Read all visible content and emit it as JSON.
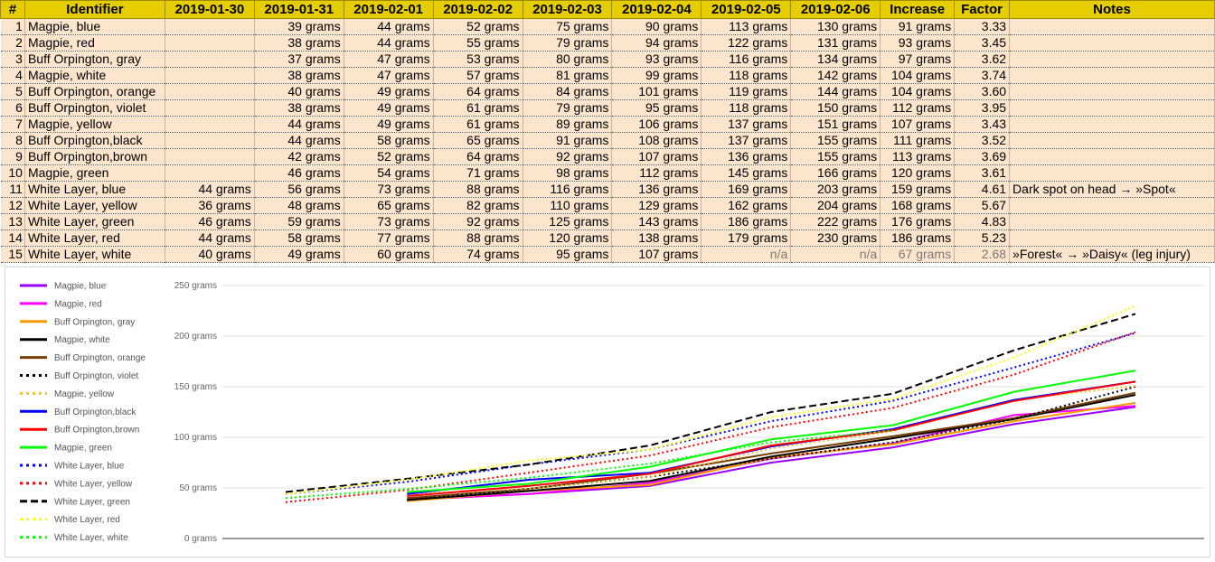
{
  "sheet": {
    "columns": [
      "#",
      "Identifier",
      "2019-01-30",
      "2019-01-31",
      "2019-02-01",
      "2019-02-02",
      "2019-02-03",
      "2019-02-04",
      "2019-02-05",
      "2019-02-06",
      "Increase",
      "Factor",
      "Notes"
    ],
    "rows": [
      {
        "n": "1",
        "id": "Magpie, blue",
        "d": [
          "",
          "39 grams",
          "44 grams",
          "52 grams",
          "75 grams",
          "90 grams",
          "113 grams",
          "130 grams"
        ],
        "inc": "91 grams",
        "f": "3.33",
        "note": ""
      },
      {
        "n": "2",
        "id": "Magpie, red",
        "d": [
          "",
          "38 grams",
          "44 grams",
          "55 grams",
          "79 grams",
          "94 grams",
          "122 grams",
          "131 grams"
        ],
        "inc": "93 grams",
        "f": "3.45",
        "note": ""
      },
      {
        "n": "3",
        "id": "Buff Orpington, gray",
        "d": [
          "",
          "37 grams",
          "47 grams",
          "53 grams",
          "80 grams",
          "93 grams",
          "116 grams",
          "134 grams"
        ],
        "inc": "97 grams",
        "f": "3.62",
        "note": ""
      },
      {
        "n": "4",
        "id": "Magpie, white",
        "d": [
          "",
          "38 grams",
          "47 grams",
          "57 grams",
          "81 grams",
          "99 grams",
          "118 grams",
          "142 grams"
        ],
        "inc": "104 grams",
        "f": "3.74",
        "note": ""
      },
      {
        "n": "5",
        "id": "Buff Orpington, orange",
        "d": [
          "",
          "40 grams",
          "49 grams",
          "64 grams",
          "84 grams",
          "101 grams",
          "119 grams",
          "144 grams"
        ],
        "inc": "104 grams",
        "f": "3.60",
        "note": ""
      },
      {
        "n": "6",
        "id": "Buff Orpington, violet",
        "d": [
          "",
          "38 grams",
          "49 grams",
          "61 grams",
          "79 grams",
          "95 grams",
          "118 grams",
          "150 grams"
        ],
        "inc": "112 grams",
        "f": "3.95",
        "note": ""
      },
      {
        "n": "7",
        "id": "Magpie, yellow",
        "d": [
          "",
          "44 grams",
          "49 grams",
          "61 grams",
          "89 grams",
          "106 grams",
          "137 grams",
          "151 grams"
        ],
        "inc": "107 grams",
        "f": "3.43",
        "note": ""
      },
      {
        "n": "8",
        "id": "Buff Orpington,black",
        "d": [
          "",
          "44 grams",
          "58 grams",
          "65 grams",
          "91 grams",
          "108 grams",
          "137 grams",
          "155 grams"
        ],
        "inc": "111 grams",
        "f": "3.52",
        "note": ""
      },
      {
        "n": "9",
        "id": "Buff Orpington,brown",
        "d": [
          "",
          "42 grams",
          "52 grams",
          "64 grams",
          "92 grams",
          "107 grams",
          "136 grams",
          "155 grams"
        ],
        "inc": "113 grams",
        "f": "3.69",
        "note": ""
      },
      {
        "n": "10",
        "id": "Magpie, green",
        "d": [
          "",
          "46 grams",
          "54 grams",
          "71 grams",
          "98 grams",
          "112 grams",
          "145 grams",
          "166 grams"
        ],
        "inc": "120 grams",
        "f": "3.61",
        "note": ""
      },
      {
        "n": "11",
        "id": "White Layer, blue",
        "d": [
          "44 grams",
          "56 grams",
          "73 grams",
          "88 grams",
          "116 grams",
          "136 grams",
          "169 grams",
          "203 grams"
        ],
        "inc": "159 grams",
        "f": "4.61",
        "note": "Dark spot on head → »Spot«"
      },
      {
        "n": "12",
        "id": "White Layer, yellow",
        "d": [
          "36 grams",
          "48 grams",
          "65 grams",
          "82 grams",
          "110 grams",
          "129 grams",
          "162 grams",
          "204 grams"
        ],
        "inc": "168 grams",
        "f": "5.67",
        "note": ""
      },
      {
        "n": "13",
        "id": "White Layer, green",
        "d": [
          "46 grams",
          "59 grams",
          "73 grams",
          "92 grams",
          "125 grams",
          "143 grams",
          "186 grams",
          "222 grams"
        ],
        "inc": "176 grams",
        "f": "4.83",
        "note": ""
      },
      {
        "n": "14",
        "id": "White Layer, red",
        "d": [
          "44 grams",
          "58 grams",
          "77 grams",
          "88 grams",
          "120 grams",
          "138 grams",
          "179 grams",
          "230 grams"
        ],
        "inc": "186 grams",
        "f": "5.23",
        "note": ""
      },
      {
        "n": "15",
        "id": "White Layer, white",
        "d": [
          "40 grams",
          "49 grams",
          "60 grams",
          "74 grams",
          "95 grams",
          "107 grams",
          "n/a",
          "n/a"
        ],
        "inc": "67 grams",
        "f": "2.68",
        "note": "»Forest« → »Daisy« (leg injury)"
      }
    ]
  },
  "chart_data": {
    "type": "line",
    "title": "",
    "xlabel": "",
    "ylabel": "",
    "ylim": [
      0,
      250
    ],
    "y_ticks": [
      "0 grams",
      "50 grams",
      "100 grams",
      "150 grams",
      "200 grams",
      "250 grams"
    ],
    "y_tick_values": [
      0,
      50,
      100,
      150,
      200,
      250
    ],
    "x": [
      "2019-01-30",
      "2019-01-31",
      "2019-02-01",
      "2019-02-02",
      "2019-02-03",
      "2019-02-04",
      "2019-02-05",
      "2019-02-06"
    ],
    "x_labels_visible": false,
    "grid": true,
    "legend_position": "left",
    "series": [
      {
        "name": "Magpie, blue",
        "color": "#9900ff",
        "dash": "solid",
        "values": [
          null,
          39,
          44,
          52,
          75,
          90,
          113,
          130
        ]
      },
      {
        "name": "Magpie, red",
        "color": "#ff00ff",
        "dash": "solid",
        "values": [
          null,
          38,
          44,
          55,
          79,
          94,
          122,
          131
        ]
      },
      {
        "name": "Buff Orpington, gray",
        "color": "#ff9900",
        "dash": "solid",
        "values": [
          null,
          37,
          47,
          53,
          80,
          93,
          116,
          134
        ]
      },
      {
        "name": "Magpie, white",
        "color": "#000000",
        "dash": "solid",
        "values": [
          null,
          38,
          47,
          57,
          81,
          99,
          118,
          142
        ]
      },
      {
        "name": "Buff Orpington, orange",
        "color": "#783f04",
        "dash": "solid",
        "values": [
          null,
          40,
          49,
          64,
          84,
          101,
          119,
          144
        ]
      },
      {
        "name": "Buff Orpington, violet",
        "color": "#000000",
        "dash": "dotted",
        "values": [
          null,
          38,
          49,
          61,
          79,
          95,
          118,
          150
        ]
      },
      {
        "name": "Magpie, yellow",
        "color": "#f1c232",
        "dash": "dotted",
        "values": [
          null,
          44,
          49,
          61,
          89,
          106,
          137,
          151
        ]
      },
      {
        "name": "Buff Orpington,black",
        "color": "#0000ff",
        "dash": "solid",
        "values": [
          null,
          44,
          58,
          65,
          91,
          108,
          137,
          155
        ]
      },
      {
        "name": "Buff Orpington,brown",
        "color": "#ff0000",
        "dash": "solid",
        "values": [
          null,
          42,
          52,
          64,
          92,
          107,
          136,
          155
        ]
      },
      {
        "name": "Magpie, green",
        "color": "#00ff00",
        "dash": "solid",
        "values": [
          null,
          46,
          54,
          71,
          98,
          112,
          145,
          166
        ]
      },
      {
        "name": "White Layer, blue",
        "color": "#0000ff",
        "dash": "dotted",
        "values": [
          44,
          56,
          73,
          88,
          116,
          136,
          169,
          203
        ]
      },
      {
        "name": "White Layer, yellow",
        "color": "#ff0000",
        "dash": "dotted",
        "values": [
          36,
          48,
          65,
          82,
          110,
          129,
          162,
          204
        ]
      },
      {
        "name": "White Layer, green",
        "color": "#000000",
        "dash": "dashed",
        "values": [
          46,
          59,
          73,
          92,
          125,
          143,
          186,
          222
        ]
      },
      {
        "name": "White Layer, red",
        "color": "#ffff00",
        "dash": "dotted",
        "values": [
          44,
          58,
          77,
          88,
          120,
          138,
          179,
          230
        ]
      },
      {
        "name": "White Layer, white",
        "color": "#00ff00",
        "dash": "dotted",
        "values": [
          40,
          49,
          60,
          74,
          95,
          107,
          null,
          null
        ]
      }
    ]
  }
}
